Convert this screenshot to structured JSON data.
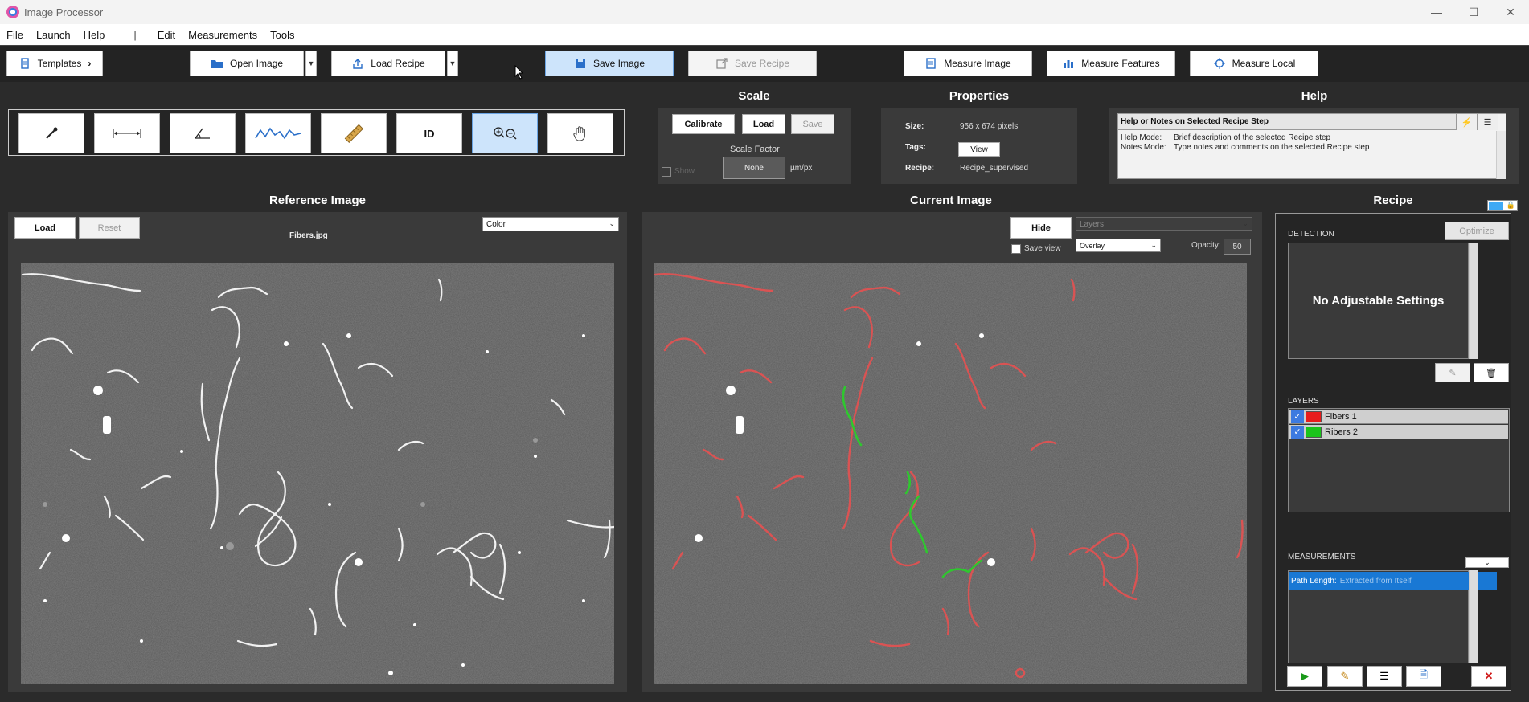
{
  "window": {
    "title": "Image Processor"
  },
  "menu": {
    "items": [
      "File",
      "Launch",
      "Help"
    ],
    "separator": "|",
    "items2": [
      "Edit",
      "Measurements",
      "Tools"
    ]
  },
  "toolbar": {
    "templates": "Templates",
    "open_image": "Open Image",
    "load_recipe": "Load Recipe",
    "save_image": "Save Image",
    "save_recipe": "Save Recipe",
    "measure_image": "Measure Image",
    "measure_features": "Measure Features",
    "measure_local": "Measure Local"
  },
  "tools": {
    "id_label": "ID"
  },
  "scale": {
    "title": "Scale",
    "calibrate": "Calibrate",
    "load": "Load",
    "save": "Save",
    "factor_label": "Scale Factor",
    "factor_value": "None",
    "unit": "µm/px",
    "show": "Show"
  },
  "properties": {
    "title": "Properties",
    "size_label": "Size:",
    "size_value": "956 x 674 pixels",
    "tags_label": "Tags:",
    "view": "View",
    "recipe_label": "Recipe:",
    "recipe_value": "Recipe_supervised"
  },
  "help": {
    "title": "Help",
    "header": "Help or Notes on Selected Recipe Step",
    "help_mode_key": "Help Mode:",
    "help_mode_val": "Brief description of the selected Recipe step",
    "notes_mode_key": "Notes Mode:",
    "notes_mode_val": "Type notes and comments on the selected Recipe step"
  },
  "reference": {
    "title": "Reference Image",
    "load": "Load",
    "reset": "Reset",
    "filename": "Fibers.jpg",
    "color_select": "Color"
  },
  "current": {
    "title": "Current Image",
    "hide": "Hide",
    "layers_select": "Layers",
    "save_view": "Save view",
    "overlay_select": "Overlay",
    "opacity_label": "Opacity:",
    "opacity_value": "50"
  },
  "recipe": {
    "title": "Recipe",
    "detection_label": "DETECTION",
    "optimize": "Optimize",
    "no_settings": "No Adjustable Settings",
    "layers_label": "LAYERS",
    "layers": [
      {
        "name": "Fibers 1",
        "color": "#e81c1c"
      },
      {
        "name": "Ribers 2",
        "color": "#1bc41b"
      }
    ],
    "measurements_label": "MEASUREMENTS",
    "measurement_name": "Path Length:",
    "measurement_source": "Extracted from Itself"
  },
  "colors": {
    "accent": "#1978d4",
    "selected_bg": "#cde4fb",
    "panel": "#3a3a3a",
    "bg": "#2b2b2b"
  }
}
